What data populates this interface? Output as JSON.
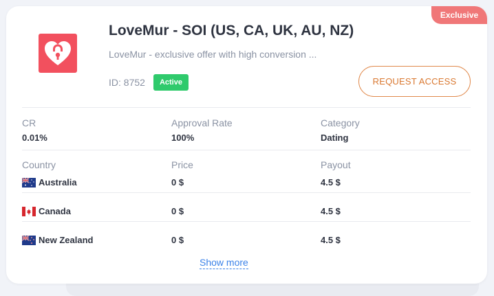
{
  "offer": {
    "badge": "Exclusive",
    "title": "LoveMur - SOI (US, CA, UK, AU, NZ)",
    "description": "LoveMur - exclusive offer with high conversion ...",
    "id_label": "ID: 8752",
    "status": "Active",
    "request_button": "REQUEST ACCESS",
    "logo_icon": "heart-lock-icon",
    "brand_color": "#f2505e",
    "accent_color": "#d9772f"
  },
  "stats": [
    {
      "label": "CR",
      "value": "0.01%"
    },
    {
      "label": "Approval Rate",
      "value": "100%"
    },
    {
      "label": "Category",
      "value": "Dating"
    }
  ],
  "table": {
    "headers": [
      "Country",
      "Price",
      "Payout"
    ],
    "rows": [
      {
        "country": "Australia",
        "flag": "au-flag-icon",
        "price": "0 $",
        "payout": "4.5 $"
      },
      {
        "country": "Canada",
        "flag": "ca-flag-icon",
        "price": "0 $",
        "payout": "4.5 $"
      },
      {
        "country": "New Zealand",
        "flag": "nz-flag-icon",
        "price": "0 $",
        "payout": "4.5 $"
      }
    ]
  },
  "show_more": "Show more"
}
